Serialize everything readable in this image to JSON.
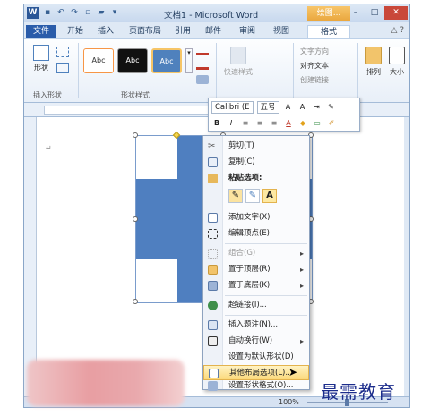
{
  "titlebar": {
    "app_icon": "W",
    "title": "文档1 - Microsoft Word",
    "context_group": "绘图...",
    "qat_icons": [
      "save-icon",
      "undo-icon",
      "redo-icon",
      "new-doc-icon",
      "open-icon",
      "customize-icon"
    ]
  },
  "tabs": [
    {
      "label": "文件"
    },
    {
      "label": "开始"
    },
    {
      "label": "插入"
    },
    {
      "label": "页面布局"
    },
    {
      "label": "引用"
    },
    {
      "label": "邮件"
    },
    {
      "label": "审阅"
    },
    {
      "label": "视图"
    },
    {
      "label": "格式"
    }
  ],
  "ribbon": {
    "insert_shapes": {
      "shape_label": "形状",
      "group_label": "插入形状"
    },
    "shape_styles": {
      "style_sample": "Abc",
      "group_label": "形状样式"
    },
    "quick_styles": "快速样式",
    "text_direction": "文字方向",
    "align_text": "对齐文本",
    "create_link": "创建链接",
    "arrange": "排列",
    "size": "大小"
  },
  "mini_toolbar": {
    "font": "Calibri (E",
    "size": "五号",
    "bold": "B",
    "italic": "I",
    "align_left": "≡",
    "align_center": "≡",
    "align_right": "≡",
    "font_color": "A"
  },
  "context_menu": {
    "cut": "剪切(T)",
    "copy": "复制(C)",
    "paste_options": "粘贴选项:",
    "paste_keep_text": "A",
    "add_text": "添加文字(X)",
    "edit_points": "编辑顶点(E)",
    "group": "组合(G)",
    "bring_front": "置于顶层(R)",
    "send_back": "置于底层(K)",
    "hyperlink": "超链接(I)...",
    "insert_caption": "插入题注(N)...",
    "wrap_text": "自动换行(W)",
    "set_default": "设置为默认形状(D)",
    "more_layout": "其他布局选项(L)...",
    "format_shape": "设置形状格式(O)..."
  },
  "status": {
    "zoom": "100%"
  },
  "watermark": "最需教育"
}
